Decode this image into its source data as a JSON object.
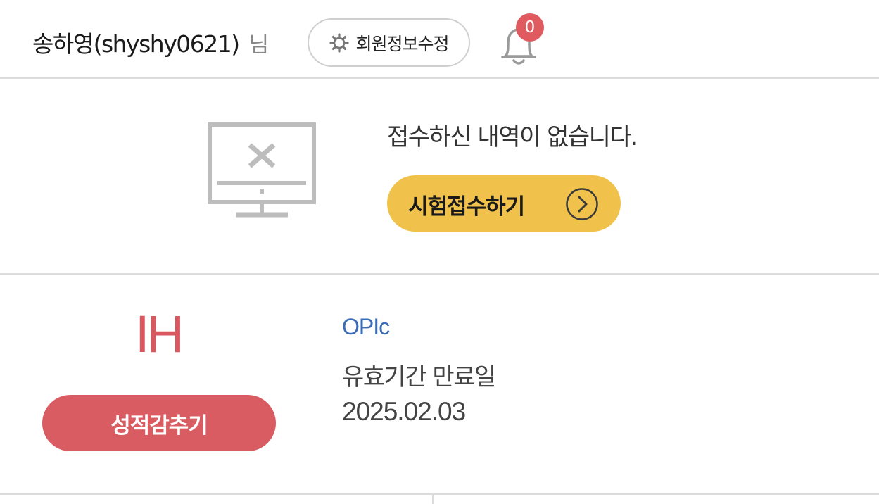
{
  "header": {
    "user_display": "송하영(shyshy0621)",
    "user_suffix": "님",
    "profile_edit_label": "회원정보수정",
    "notification_count": "0"
  },
  "empty_state": {
    "message": "접수하신 내역이 없습니다.",
    "apply_label": "시험접수하기"
  },
  "score": {
    "grade": "IH",
    "hide_label": "성적감추기",
    "exam_name": "OPIc",
    "expiry_label": "유효기간 만료일",
    "expiry_date": "2025.02.03"
  },
  "colors": {
    "apply_button": "#f0c24b",
    "hide_button": "#d95c62",
    "grade_text": "#d9575e",
    "exam_name_text": "#3a6db5",
    "badge": "#e05b60"
  },
  "icons": {
    "profile_button": "gear-icon",
    "notifications": "bell-icon",
    "empty_state": "monitor-x-icon",
    "apply_button": "chevron-right-circle-icon"
  }
}
